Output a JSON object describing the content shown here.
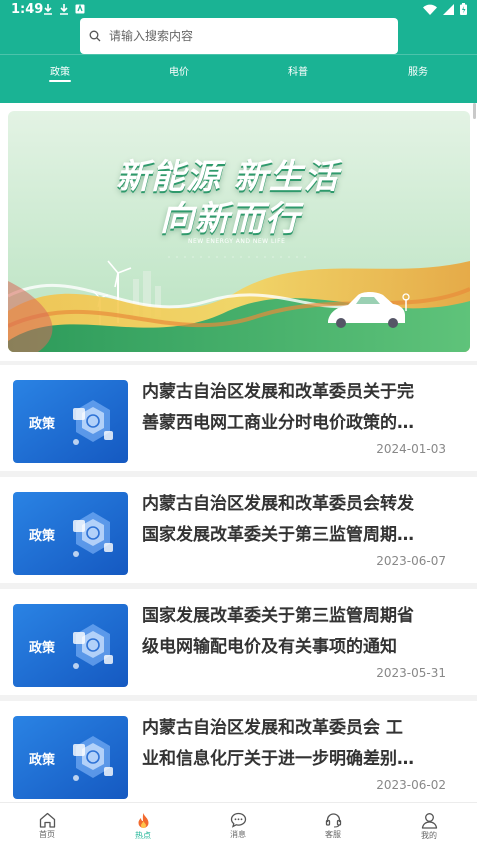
{
  "status_bar": {
    "time": "1:49"
  },
  "search": {
    "placeholder": "请输入搜索内容"
  },
  "tabs": [
    {
      "label": "政策",
      "active": true
    },
    {
      "label": "电价",
      "active": false
    },
    {
      "label": "科普",
      "active": false
    },
    {
      "label": "服务",
      "active": false
    }
  ],
  "banner": {
    "headline_1": "新能源 新生活",
    "headline_2": "向新而行",
    "subtitle": "NEW ENERGY AND NEW LIFE"
  },
  "articles": [
    {
      "tag": "政策",
      "title": "内蒙古自治区发展和改革委员关于完善蒙西电网工商业分时电价政策的通知",
      "date": "2024-01-03"
    },
    {
      "tag": "政策",
      "title": "内蒙古自治区发展和改革委员会转发国家发展改革委关于第三监管周期省级电网输配电价的通知",
      "date": "2023-06-07"
    },
    {
      "tag": "政策",
      "title": "国家发展改革委关于第三监管周期省级电网输配电价及有关事项的通知",
      "date": "2023-05-31"
    },
    {
      "tag": "政策",
      "title": "内蒙古自治区发展和改革委员会 工业和信息化厅关于进一步明确差别电价政策的通知",
      "date": "2023-06-02"
    }
  ],
  "bottom_nav": [
    {
      "label": "首页",
      "icon": "home-icon",
      "active": false
    },
    {
      "label": "热点",
      "icon": "flame-icon",
      "active": true
    },
    {
      "label": "消息",
      "icon": "message-icon",
      "active": false
    },
    {
      "label": "客服",
      "icon": "headset-icon",
      "active": false
    },
    {
      "label": "我的",
      "icon": "user-icon",
      "active": false
    }
  ],
  "colors": {
    "primary": "#1ab394",
    "thumb_blue": "#1c6fd4",
    "flame": "#f26a2e"
  }
}
